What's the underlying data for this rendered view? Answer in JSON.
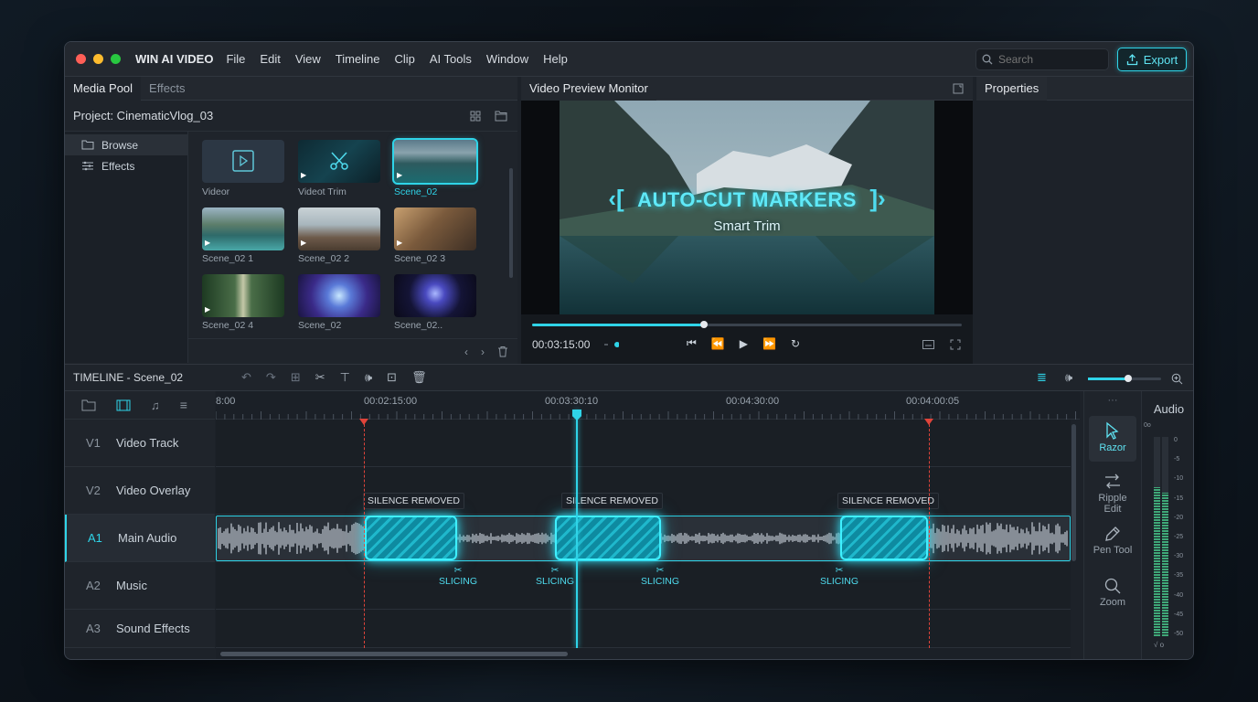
{
  "app": {
    "name": "WIN AI VIDEO"
  },
  "menu": [
    "File",
    "Edit",
    "View",
    "Timeline",
    "Clip",
    "AI Tools",
    "Window",
    "Help"
  ],
  "search": {
    "placeholder": "Search"
  },
  "export": {
    "label": "Export"
  },
  "left_panel": {
    "tabs": [
      "Media Pool",
      "Effects"
    ],
    "project": "Project: CinematicVlog_03",
    "sidebar": [
      "Browse",
      "Effects"
    ],
    "media": [
      {
        "label": "Videor"
      },
      {
        "label": "Videot Trim"
      },
      {
        "label": "Scene_02"
      },
      {
        "label": "Scene_02 1"
      },
      {
        "label": "Scene_02 2"
      },
      {
        "label": "Scene_02 3"
      },
      {
        "label": "Scene_02 4"
      },
      {
        "label": "Scene_02"
      },
      {
        "label": "Scene_02.."
      }
    ]
  },
  "monitor": {
    "tab": "Video Preview Monitor",
    "overlay_title": "AUTO-CUT MARKERS",
    "overlay_subtitle": "Smart Trim",
    "timecode": "00:03:15:00",
    "progress": 0.4
  },
  "properties": {
    "tab": "Properties"
  },
  "timeline": {
    "title": "TIMELINE - Scene_02",
    "zoom_level": 0.55,
    "ruler": [
      "8:00",
      "00:02:15:00",
      "00:03:30:10",
      "00:04:30:00",
      "00:04:00:05"
    ],
    "tracks": [
      {
        "id": "V1",
        "name": "Video Track"
      },
      {
        "id": "V2",
        "name": "Video Overlay"
      },
      {
        "id": "A1",
        "name": "Main Audio"
      },
      {
        "id": "A2",
        "name": "Music"
      },
      {
        "id": "A3",
        "name": "Sound Effects"
      }
    ],
    "silence_label": "SILENCE REMOVED",
    "slice_label": "SLICING"
  },
  "tools": [
    {
      "name": "Razor",
      "icon": "cursor-icon"
    },
    {
      "name": "Ripple Edit",
      "icon": "ripple-icon"
    },
    {
      "name": "Pen Tool",
      "icon": "pen-icon"
    },
    {
      "name": "Zoom",
      "icon": "zoom-icon"
    }
  ],
  "audio_meter": {
    "title": "Audio",
    "scale": [
      "0",
      "-5",
      "-10",
      "-15",
      "-20",
      "-25",
      "-30",
      "-35",
      "-40",
      "-45",
      "-50"
    ],
    "top_label": "0o",
    "bottom_label": "√ o",
    "levels": [
      0.75,
      0.72
    ]
  },
  "colors": {
    "accent": "#2fd4e8",
    "marker": "#e0443a"
  }
}
